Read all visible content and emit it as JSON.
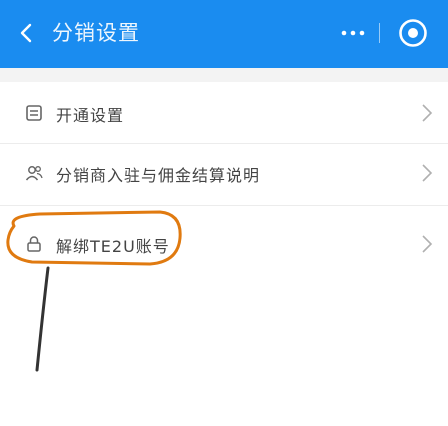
{
  "header": {
    "title": "分销设置",
    "background": "#1a8cf0"
  },
  "rows": [
    {
      "label": "开通设置",
      "icon": "document-icon"
    },
    {
      "label": "分销商入驻与佣金结算说明",
      "icon": "users-icon"
    },
    {
      "label": "解绑TE2U账号",
      "icon": "lock-icon"
    }
  ],
  "annotation": {
    "color": "#e07a10"
  }
}
